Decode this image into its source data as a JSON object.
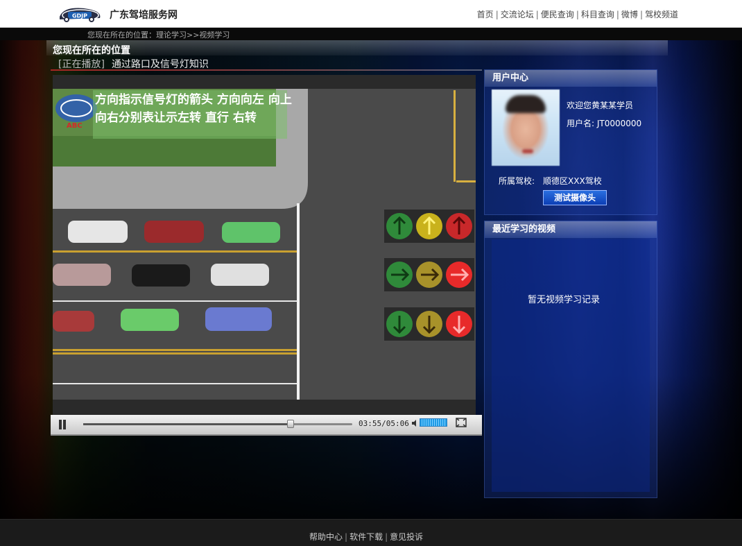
{
  "header": {
    "logo_text": "GDJP",
    "site_name": "广东驾培服务网",
    "nav": [
      "首页",
      "交流论坛",
      "便民查询",
      "科目查询",
      "微博",
      "驾校频道"
    ]
  },
  "breadcrumb": "您现在所在的位置：理论学习>>视频学习",
  "location_title": "您现在所在的位置",
  "now_playing": {
    "tag": "[正在播放]",
    "title": "通过路口及信号灯知识"
  },
  "video": {
    "caption": "方向指示信号灯的箭头 方向向左 向上 向右分别表让示左转 直行 右转",
    "watermark": "ABC",
    "current_time": "03:55",
    "duration": "05:06",
    "time_display": "03:55/05:06",
    "progress": 0.77,
    "volume": 1.0
  },
  "user_center": {
    "title": "用户中心",
    "welcome": "欢迎您黄某某学员",
    "username_label": "用户名:",
    "username": "JT0000000",
    "username_display": "用户名: JT0000000",
    "school_label": "所属驾校:",
    "school": "顺德区XXX驾校",
    "camera_button": "测试摄像头"
  },
  "recent_videos": {
    "title": "最近学习的视频",
    "empty_text": "暂无视频学习记录"
  },
  "footer": {
    "links": [
      "帮助中心",
      "软件下载",
      "意见投诉"
    ]
  },
  "colors": {
    "arrow_green": "#2f8a3a",
    "arrow_yellow": "#c9b21c",
    "arrow_red": "#c8282a",
    "accent_blue": "#1e9be6"
  }
}
